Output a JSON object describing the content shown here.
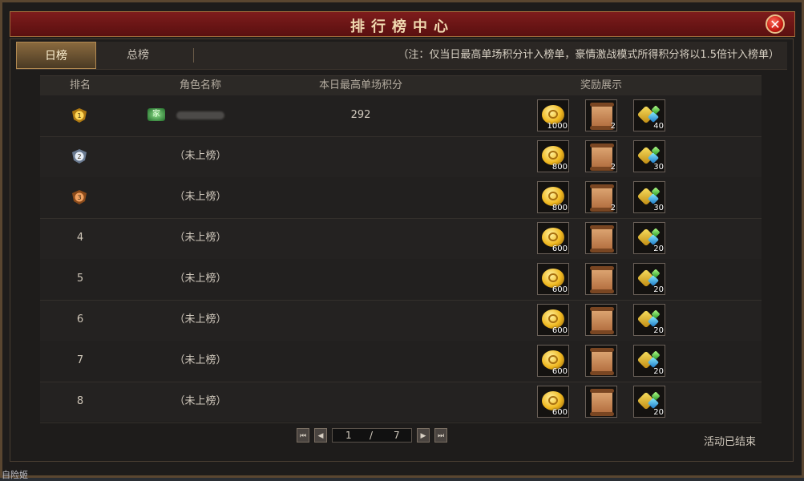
{
  "window": {
    "title": "排行榜中心",
    "close_icon": "close-icon"
  },
  "tabs": [
    {
      "label": "日榜",
      "active": true
    },
    {
      "label": "总榜",
      "active": false
    }
  ],
  "note": "（注：仅当日最高单场积分计入榜单，豪情激战模式所得积分将以1.5倍计入榜单）",
  "columns": {
    "rank": "排名",
    "name": "角色名称",
    "score": "本日最高单场积分",
    "rewards": "奖励展示"
  },
  "rows": [
    {
      "rank": "1",
      "rank_icon": "gold-medal-icon",
      "name": "",
      "score": "292",
      "rewards": [
        "1000",
        "2",
        "40"
      ]
    },
    {
      "rank": "2",
      "rank_icon": "silver-medal-icon",
      "name": "（未上榜）",
      "score": "",
      "rewards": [
        "800",
        "2",
        "30"
      ]
    },
    {
      "rank": "3",
      "rank_icon": "bronze-medal-icon",
      "name": "（未上榜）",
      "score": "",
      "rewards": [
        "800",
        "2",
        "30"
      ]
    },
    {
      "rank": "4",
      "name": "（未上榜）",
      "score": "",
      "rewards": [
        "600",
        "",
        "20"
      ]
    },
    {
      "rank": "5",
      "name": "（未上榜）",
      "score": "",
      "rewards": [
        "600",
        "",
        "20"
      ]
    },
    {
      "rank": "6",
      "name": "（未上榜）",
      "score": "",
      "rewards": [
        "600",
        "",
        "20"
      ]
    },
    {
      "rank": "7",
      "name": "（未上榜）",
      "score": "",
      "rewards": [
        "600",
        "",
        "20"
      ]
    },
    {
      "rank": "8",
      "name": "（未上榜）",
      "score": "",
      "rewards": [
        "600",
        "",
        "20"
      ]
    }
  ],
  "reward_icons": [
    "gold-coin-icon",
    "scroll-icon",
    "gem-icon"
  ],
  "first_place_badge": "家",
  "pager": {
    "current": "1",
    "separator": "/",
    "total": "7",
    "buttons": [
      "first-page",
      "prev-page",
      "next-page",
      "last-page"
    ]
  },
  "status": "活动已结束",
  "bottom_text": "自险姬"
}
